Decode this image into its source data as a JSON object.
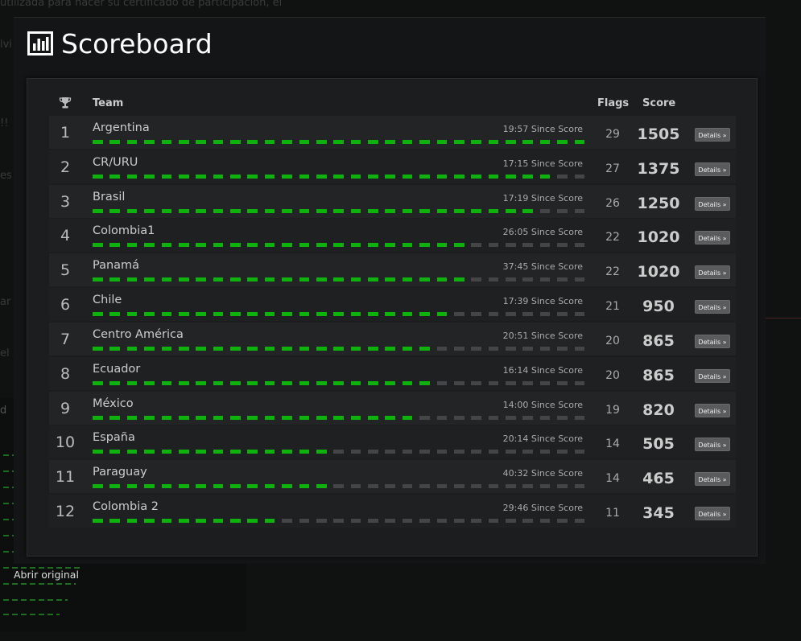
{
  "modal": {
    "title": "Scoreboard",
    "title_icon": "bar-chart-icon"
  },
  "columns": {
    "trophy_icon": "trophy-icon",
    "team": "Team",
    "flags": "Flags",
    "score": "Score"
  },
  "bar_segments_total": 29,
  "teams": [
    {
      "rank": "1",
      "name": "Argentina",
      "since": "19:57 Since Score",
      "flags": "29",
      "score": "1505",
      "details": "Details »"
    },
    {
      "rank": "2",
      "name": "CR/URU",
      "since": "17:15 Since Score",
      "flags": "27",
      "score": "1375",
      "details": "Details »"
    },
    {
      "rank": "3",
      "name": "Brasil",
      "since": "17:19 Since Score",
      "flags": "26",
      "score": "1250",
      "details": "Details »"
    },
    {
      "rank": "4",
      "name": "Colombia1",
      "since": "26:05 Since Score",
      "flags": "22",
      "score": "1020",
      "details": "Details »"
    },
    {
      "rank": "5",
      "name": "Panamá",
      "since": "37:45 Since Score",
      "flags": "22",
      "score": "1020",
      "details": "Details »"
    },
    {
      "rank": "6",
      "name": "Chile",
      "since": "17:39 Since Score",
      "flags": "21",
      "score": "950",
      "details": "Details »"
    },
    {
      "rank": "7",
      "name": "Centro América",
      "since": "20:51 Since Score",
      "flags": "20",
      "score": "865",
      "details": "Details »"
    },
    {
      "rank": "8",
      "name": "Ecuador",
      "since": "16:14 Since Score",
      "flags": "20",
      "score": "865",
      "details": "Details »"
    },
    {
      "rank": "9",
      "name": "México",
      "since": "14:00 Since Score",
      "flags": "19",
      "score": "820",
      "details": "Details »"
    },
    {
      "rank": "10",
      "name": "España",
      "since": "20:14 Since Score",
      "flags": "14",
      "score": "505",
      "details": "Details »"
    },
    {
      "rank": "11",
      "name": "Paraguay",
      "since": "40:32 Since Score",
      "flags": "14",
      "score": "465",
      "details": "Details »"
    },
    {
      "rank": "12",
      "name": "Colombia 2",
      "since": "29:46 Since Score",
      "flags": "11",
      "score": "345",
      "details": "Details »"
    }
  ],
  "footer": {
    "open_original": "Abrir original"
  },
  "background": {
    "line1": "utilizada para hacer su certificado de participación, el",
    "line2": "lvi",
    "line3": "!!",
    "line4": "es",
    "line5": "ar",
    "line6": "el p",
    "line7": "d"
  },
  "colors": {
    "flag_on": "#0db20d",
    "flag_off": "#454545",
    "panel": "#1c1d1e"
  }
}
